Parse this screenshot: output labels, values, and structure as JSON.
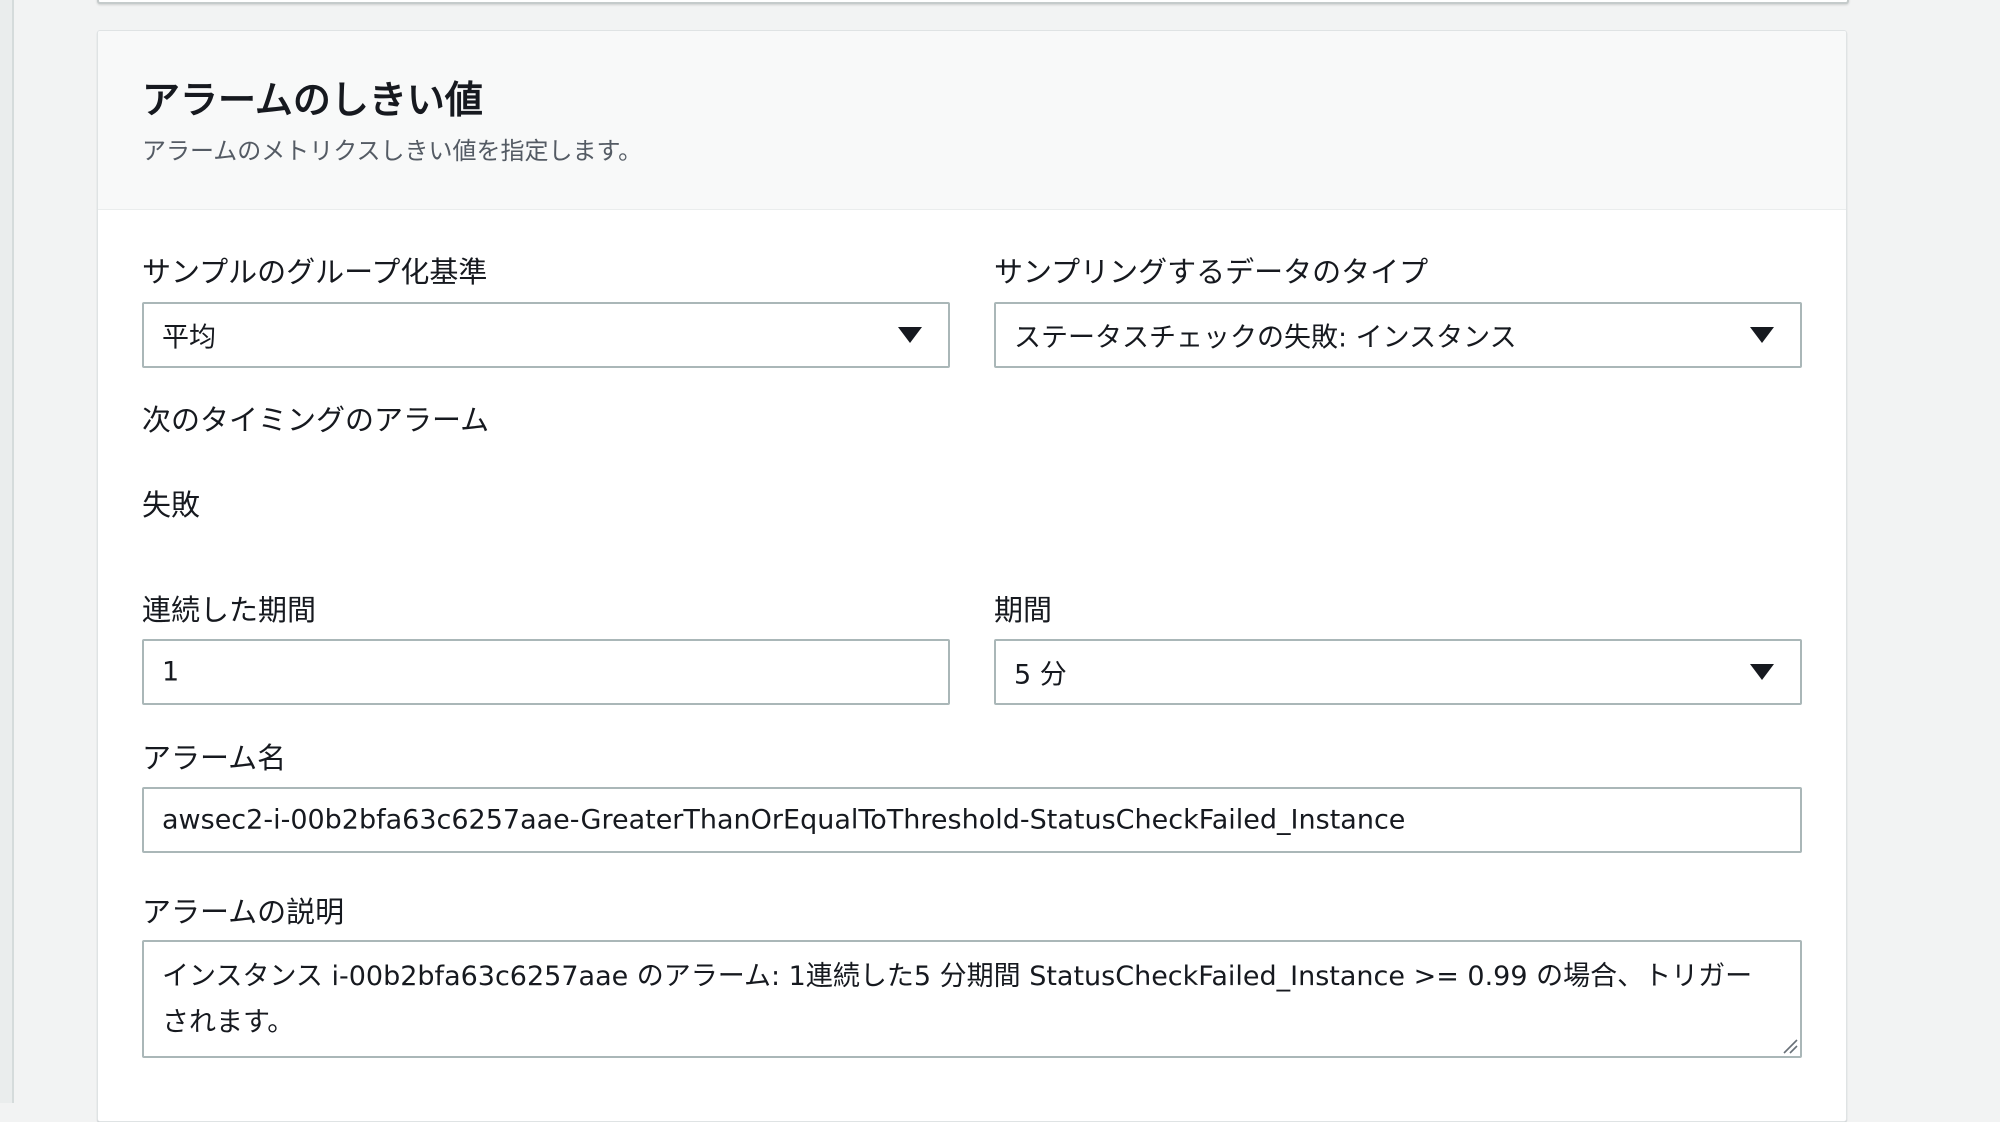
{
  "section": {
    "title": "アラームのしきい値",
    "description": "アラームのメトリクスしきい値を指定します。"
  },
  "fields": {
    "grouping": {
      "label": "サンプルのグループ化基準",
      "value": "平均"
    },
    "data_type": {
      "label": "サンプリングするデータのタイプ",
      "value": "ステータスチェックの失敗: インスタンス"
    },
    "alarm_when": {
      "label": "次のタイミングのアラーム",
      "value": "失敗"
    },
    "consecutive_periods": {
      "label": "連続した期間",
      "value": "1"
    },
    "period": {
      "label": "期間",
      "value": "5 分"
    },
    "alarm_name": {
      "label": "アラーム名",
      "value": "awsec2-i-00b2bfa63c6257aae-GreaterThanOrEqualToThreshold-StatusCheckFailed_Instance"
    },
    "alarm_description": {
      "label": "アラームの説明",
      "value": "インスタンス i-00b2bfa63c6257aae のアラーム: 1連続した5 分期間 StatusCheckFailed_Instance >= 0.99 の場合、トリガーされます。"
    }
  },
  "icons": {
    "dropdown": "caret-down-icon",
    "resize": "resize-handle-icon"
  },
  "colors": {
    "page_background": "#f2f3f3",
    "card_background": "#ffffff",
    "header_background": "#f8f9f9",
    "input_border": "#aab7b8",
    "text_primary": "#16191f",
    "text_secondary": "#545b64"
  }
}
